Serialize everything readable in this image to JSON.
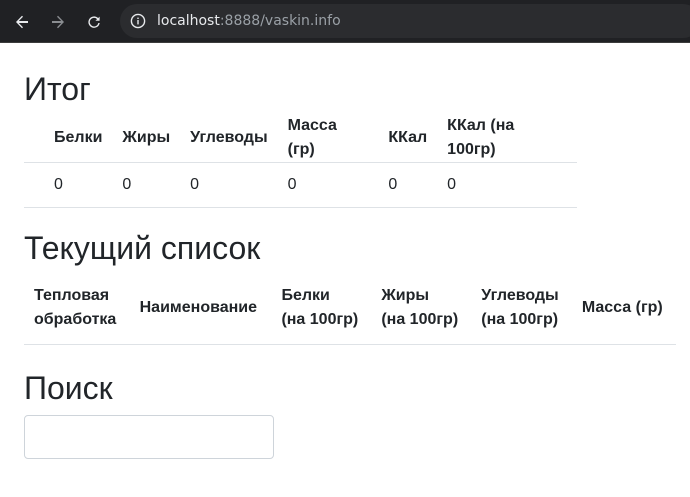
{
  "browser": {
    "url_host": "localhost",
    "url_rest": ":8888/vaskin.info",
    "colors": {
      "chrome_bg": "#202124",
      "omnibox_bg": "#2b2c2f"
    },
    "icons": [
      "back-arrow-icon",
      "forward-arrow-icon",
      "reload-icon",
      "info-icon"
    ]
  },
  "summary": {
    "title": "Итог",
    "columns": [
      "Белки",
      "Жиры",
      "Углеводы",
      "Масса (гр)",
      "ККал",
      "ККал (на 100гр)"
    ],
    "values": [
      "0",
      "0",
      "0",
      "0",
      "0",
      "0"
    ]
  },
  "current_list": {
    "title": "Текущий список",
    "columns": [
      [
        "Тепловая",
        "обработка"
      ],
      [
        "Наименование"
      ],
      [
        "Белки",
        "(на 100гр)"
      ],
      [
        "Жиры",
        "(на 100гр)"
      ],
      [
        "Углеводы",
        "(на 100гр)"
      ],
      [
        "Масса (гр)"
      ]
    ]
  },
  "search": {
    "title": "Поиск",
    "value": "",
    "placeholder": ""
  }
}
